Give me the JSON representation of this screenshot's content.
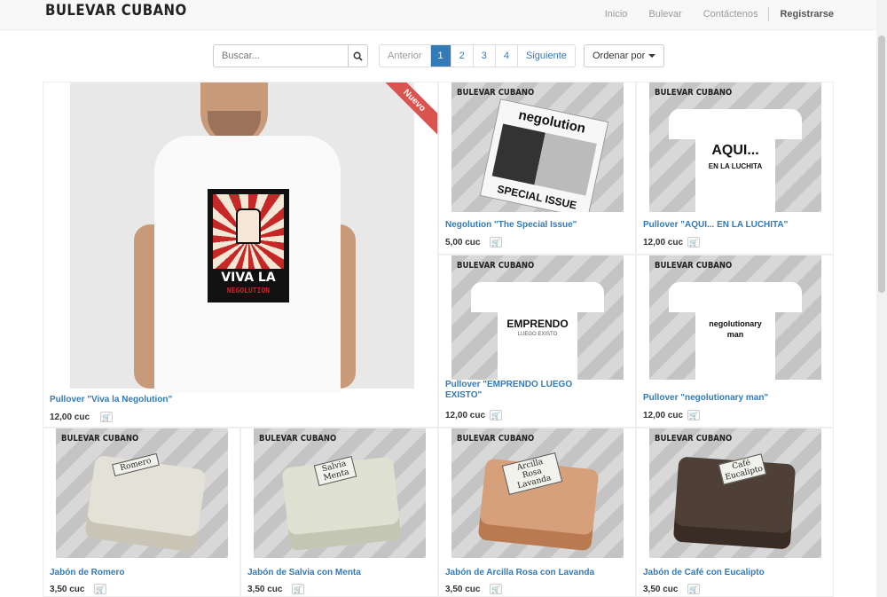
{
  "brand": "BULEVAR CUBANO",
  "nav": {
    "links": [
      "Inicio",
      "Bulevar",
      "Contáctenos"
    ],
    "register": "Registrarse"
  },
  "search": {
    "placeholder": "Buscar..."
  },
  "pagination": {
    "prev": "Anterior",
    "pages": [
      "1",
      "2",
      "3",
      "4"
    ],
    "active_page": "1",
    "next": "Siguiente"
  },
  "sort": {
    "label": "Ordenar por"
  },
  "featured": {
    "badge": "Nuevo",
    "shirt_line1": "VIVA LA",
    "shirt_line2": "NEGOLUTION",
    "name": "Pullover \"Viva la Negolution\"",
    "price": "12,00 cuc"
  },
  "products": [
    {
      "logo": "BULEVAR CUBANO",
      "name": "Negolution \"The Special Issue\"",
      "price": "5,00 cuc",
      "art_line1": "negolution",
      "art_line2": "SPECIAL ISSUE"
    },
    {
      "logo": "BULEVAR CUBANO",
      "name": "Pullover \"AQUI... EN LA LUCHITA\"",
      "price": "12,00 cuc",
      "art_line1": "AQUI...",
      "art_line2": "EN LA LUCHITA"
    },
    {
      "logo": "BULEVAR CUBANO",
      "name": "Pullover \"EMPRENDO LUEGO EXISTO\"",
      "price": "12,00 cuc",
      "art_line1": "EMPRENDO",
      "art_line2": "LUEGO EXISTO"
    },
    {
      "logo": "BULEVAR CUBANO",
      "name": "Pullover \"negolutionary man\"",
      "price": "12,00 cuc",
      "art_line1": "negolutionary",
      "art_line2": "man"
    },
    {
      "logo": "BULEVAR CUBANO",
      "name": "Jabón de Romero",
      "price": "3,50 cuc",
      "label": "Romero"
    },
    {
      "logo": "BULEVAR CUBANO",
      "name": "Jabón de Salvia con Menta",
      "price": "3,50 cuc",
      "label": "Salvia Menta"
    },
    {
      "logo": "BULEVAR CUBANO",
      "name": "Jabón de Arcilla Rosa con Lavanda",
      "price": "3,50 cuc",
      "label": "Arcilla Rosa Lavanda"
    },
    {
      "logo": "BULEVAR CUBANO",
      "name": "Jabón de Café con Eucalipto",
      "price": "3,50 cuc",
      "label": "Café Eucalipto"
    }
  ],
  "colors": {
    "accent": "#337ab7",
    "badge": "#d9534f"
  },
  "icons": {
    "search": "search-icon",
    "cart": "cart-icon",
    "caret": "caret-down-icon"
  }
}
